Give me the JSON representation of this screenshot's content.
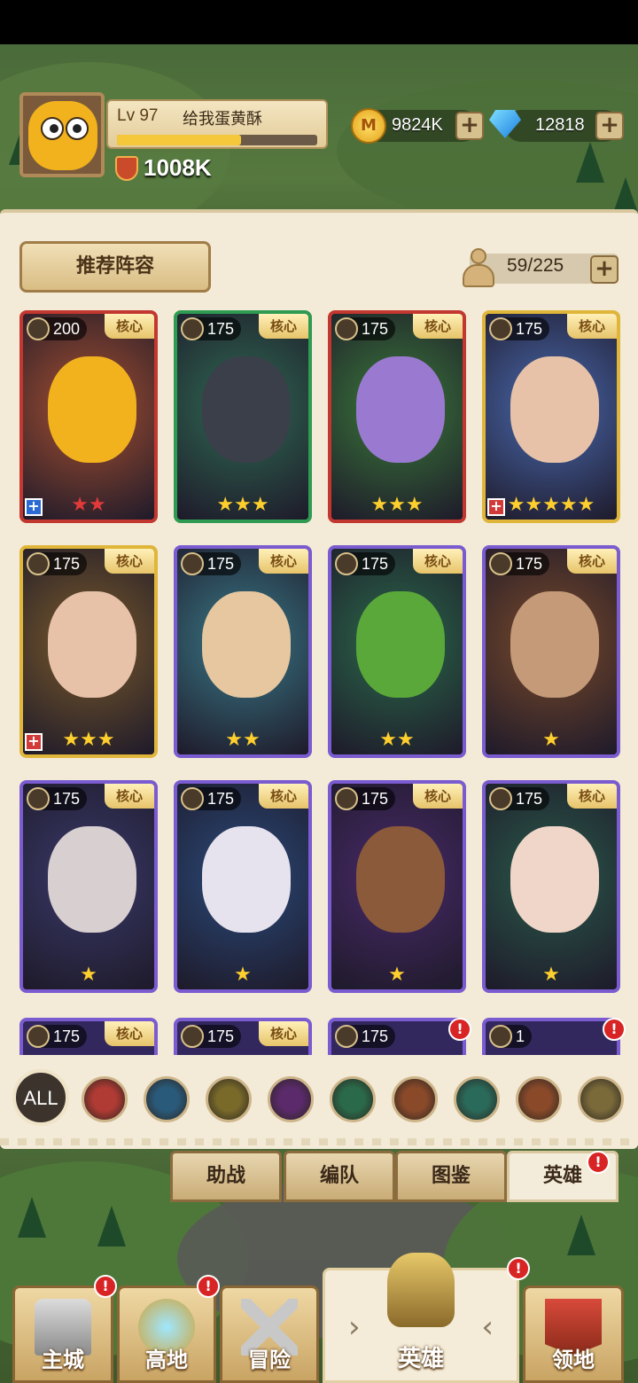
{
  "player": {
    "level": "Lv 97",
    "name": "给我蛋黄酥",
    "power": "1008K",
    "xp_fraction": 0.62
  },
  "resources": {
    "gold": "9824K",
    "gold_symbol": "M",
    "gems": "12818",
    "plus": "+"
  },
  "panel": {
    "recommend_label": "推荐阵容",
    "hero_count": "59/225"
  },
  "core_tag": "核心",
  "cards": [
    {
      "level": "200",
      "stars": 2,
      "star_color": "red",
      "plus": "blue",
      "border": "red"
    },
    {
      "level": "175",
      "stars": 3,
      "star_color": "gold",
      "border": "green"
    },
    {
      "level": "175",
      "stars": 3,
      "star_color": "gold",
      "border": "red"
    },
    {
      "level": "175",
      "stars": 5,
      "star_color": "gold",
      "plus": "red",
      "border": "gold"
    },
    {
      "level": "175",
      "stars": 3,
      "star_color": "gold",
      "plus": "red",
      "border": "gold"
    },
    {
      "level": "175",
      "stars": 2,
      "star_color": "gold",
      "border": "purple"
    },
    {
      "level": "175",
      "stars": 2,
      "star_color": "gold",
      "border": "purple"
    },
    {
      "level": "175",
      "stars": 1,
      "star_color": "gold",
      "border": "purple"
    },
    {
      "level": "175",
      "stars": 1,
      "star_color": "gold",
      "border": "purple"
    },
    {
      "level": "175",
      "stars": 1,
      "star_color": "gold",
      "border": "purple"
    },
    {
      "level": "175",
      "stars": 1,
      "star_color": "gold",
      "border": "purple"
    },
    {
      "level": "175",
      "stars": 1,
      "star_color": "gold",
      "border": "purple"
    }
  ],
  "partial_cards": [
    {
      "level": "175",
      "core": true
    },
    {
      "level": "175",
      "core": true
    },
    {
      "level": "175",
      "core": false,
      "alert": true
    },
    {
      "level": "1",
      "core": false,
      "alert": true
    }
  ],
  "filters": {
    "all_label": "ALL",
    "icons": [
      "shield-icon",
      "staff-icon",
      "wings-icon",
      "skull-icon",
      "crossed-swords-icon",
      "paw-icon",
      "bow-icon",
      "bull-icon",
      "hammer-icon"
    ]
  },
  "tabs": [
    "助战",
    "编队",
    "图鉴",
    "英雄"
  ],
  "alert_symbol": "!",
  "nav": [
    {
      "label": "主城",
      "alert": true
    },
    {
      "label": "高地",
      "alert": true
    },
    {
      "label": "冒险",
      "alert": false
    },
    {
      "label": "英雄",
      "alert": false,
      "active": true
    },
    {
      "label": "领地",
      "alert": true
    }
  ],
  "colors": {
    "red": "#c2372f",
    "green": "#2f9a52",
    "gold": "#e0b63a",
    "purple": "#7a5bd0"
  }
}
